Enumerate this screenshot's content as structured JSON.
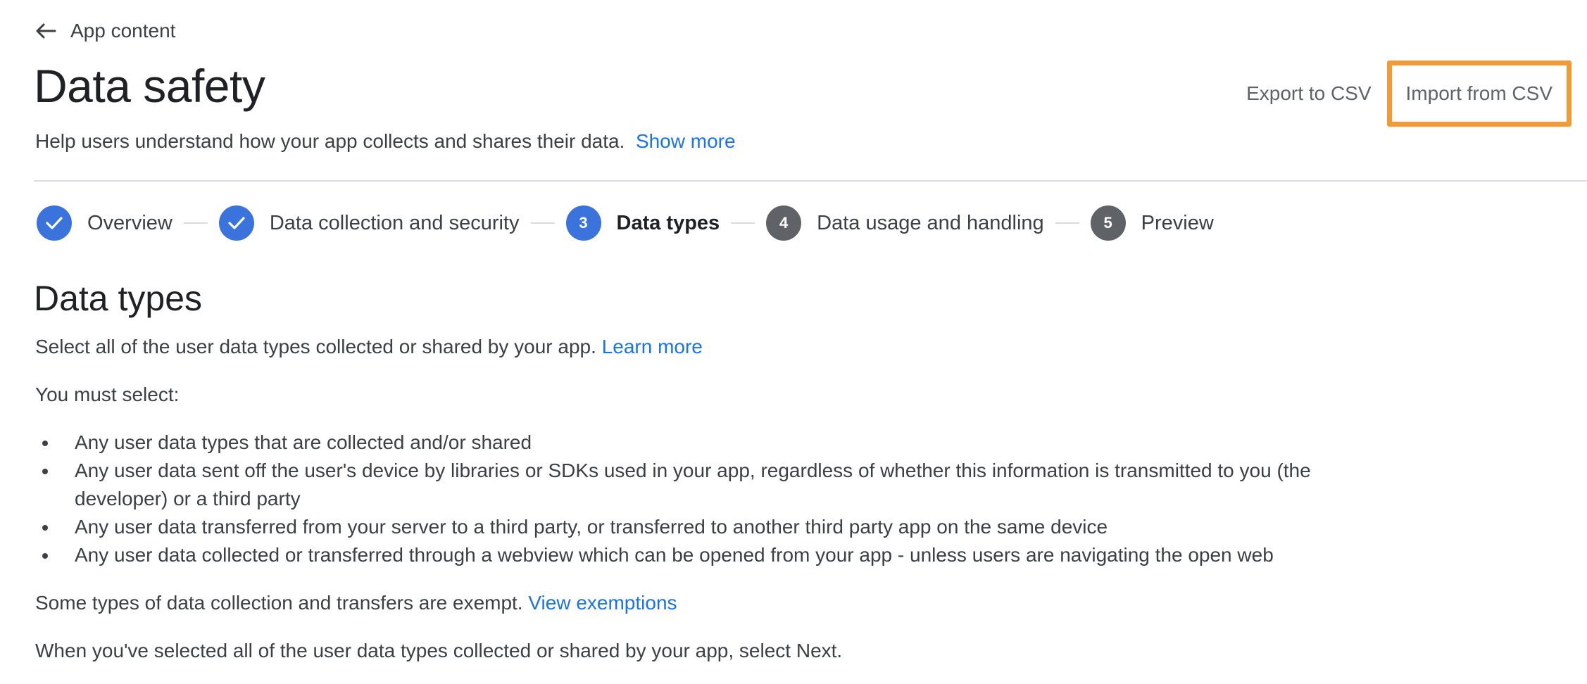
{
  "nav": {
    "back_label": "App content"
  },
  "header": {
    "title": "Data safety",
    "subtitle": "Help users understand how your app collects and shares their data.",
    "show_more": "Show more",
    "export_label": "Export to CSV",
    "import_label": "Import from CSV",
    "highlight_color": "#f29a36"
  },
  "stepper": {
    "steps": [
      {
        "number": "1",
        "label": "Overview",
        "state": "done"
      },
      {
        "number": "2",
        "label": "Data collection and security",
        "state": "done"
      },
      {
        "number": "3",
        "label": "Data types",
        "state": "current"
      },
      {
        "number": "4",
        "label": "Data usage and handling",
        "state": "pending"
      },
      {
        "number": "5",
        "label": "Preview",
        "state": "pending"
      }
    ]
  },
  "content": {
    "section_title": "Data types",
    "intro": "Select all of the user data types collected or shared by your app.",
    "learn_more": "Learn more",
    "must_select": "You must select:",
    "bullets": [
      "Any user data types that are collected and/or shared",
      "Any user data sent off the user's device by libraries or SDKs used in your app, regardless of whether this information is transmitted to you (the developer) or a third party",
      "Any user data transferred from your server to a third party, or transferred to another third party app on the same device",
      "Any user data collected or transferred through a webview which can be opened from your app - unless users are navigating the open web"
    ],
    "exempt_text": "Some types of data collection and transfers are exempt.",
    "view_exemptions": "View exemptions",
    "next_text": "When you've selected all of the user data types collected or shared by your app, select Next."
  }
}
